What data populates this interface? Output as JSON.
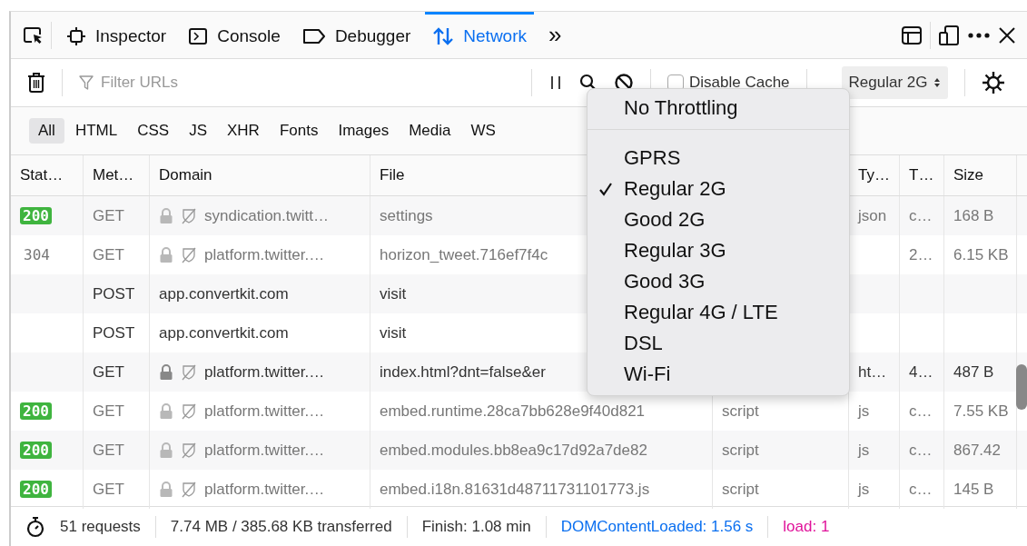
{
  "toolbar": {
    "tabs": [
      {
        "label": "Inspector",
        "selected": false
      },
      {
        "label": "Console",
        "selected": false
      },
      {
        "label": "Debugger",
        "selected": false
      },
      {
        "label": "Network",
        "selected": true
      }
    ],
    "overflow": "»"
  },
  "filter_bar": {
    "placeholder": "Filter URLs",
    "disable_cache": {
      "label": "Disable Cache",
      "checked": false
    },
    "throttle": "Regular 2G"
  },
  "type_filters": [
    {
      "label": "All",
      "selected": true
    },
    {
      "label": "HTML",
      "selected": false
    },
    {
      "label": "CSS",
      "selected": false
    },
    {
      "label": "JS",
      "selected": false
    },
    {
      "label": "XHR",
      "selected": false
    },
    {
      "label": "Fonts",
      "selected": false
    },
    {
      "label": "Images",
      "selected": false
    },
    {
      "label": "Media",
      "selected": false
    },
    {
      "label": "WS",
      "selected": false
    }
  ],
  "table": {
    "columns": [
      "Stat…",
      "Met…",
      "Domain",
      "File",
      "",
      "Ty…",
      "T…",
      "Size"
    ],
    "rows": [
      {
        "status": "200",
        "status_badge": true,
        "method": "GET",
        "secure": true,
        "faded": true,
        "domain": "syndication.twitt…",
        "file": "settings",
        "cause": "",
        "type": "json",
        "transferred": "c…",
        "size": "168 B"
      },
      {
        "status": "304",
        "status_badge": false,
        "method": "GET",
        "secure": true,
        "faded": true,
        "domain": "platform.twitter.…",
        "file": "horizon_tweet.716ef7f4c",
        "cause": "",
        "type": "",
        "transferred": "2…",
        "size": "6.15 KB"
      },
      {
        "status": "",
        "method": "POST",
        "secure": false,
        "faded": false,
        "domain": "app.convertkit.com",
        "file": "visit",
        "cause": "",
        "type": "",
        "transferred": "",
        "size": ""
      },
      {
        "status": "",
        "method": "POST",
        "secure": false,
        "faded": false,
        "domain": "app.convertkit.com",
        "file": "visit",
        "cause": "",
        "type": "",
        "transferred": "",
        "size": ""
      },
      {
        "status": "",
        "method": "GET",
        "secure": true,
        "faded": false,
        "domain": "platform.twitter.…",
        "file": "index.html?dnt=false&er",
        "cause": "",
        "type": "ht…",
        "transferred": "4…",
        "size": "487 B"
      },
      {
        "status": "200",
        "status_badge": true,
        "method": "GET",
        "secure": true,
        "faded": true,
        "domain": "platform.twitter.…",
        "file": "embed.runtime.28ca7bb628e9f40d821",
        "cause": "script",
        "type": "js",
        "transferred": "c…",
        "size": "7.55 KB"
      },
      {
        "status": "200",
        "status_badge": true,
        "method": "GET",
        "secure": true,
        "faded": true,
        "domain": "platform.twitter.…",
        "file": "embed.modules.bb8ea9c17d92a7de82",
        "cause": "script",
        "type": "js",
        "transferred": "c…",
        "size": "867.42"
      },
      {
        "status": "200",
        "status_badge": true,
        "method": "GET",
        "secure": true,
        "faded": true,
        "domain": "platform.twitter.…",
        "file": "embed.i18n.81631d48711731101773.js",
        "cause": "script",
        "type": "js",
        "transferred": "c…",
        "size": "145 B"
      }
    ]
  },
  "throttle_menu": [
    {
      "kind": "option",
      "label": "No Throttling",
      "selected": false
    },
    {
      "kind": "separator"
    },
    {
      "kind": "option",
      "label": "GPRS",
      "selected": false
    },
    {
      "kind": "option",
      "label": "Regular 2G",
      "selected": true
    },
    {
      "kind": "option",
      "label": "Good 2G",
      "selected": false
    },
    {
      "kind": "option",
      "label": "Regular 3G",
      "selected": false
    },
    {
      "kind": "option",
      "label": "Good 3G",
      "selected": false
    },
    {
      "kind": "option",
      "label": "Regular 4G / LTE",
      "selected": false
    },
    {
      "kind": "option",
      "label": "DSL",
      "selected": false
    },
    {
      "kind": "option",
      "label": "Wi-Fi",
      "selected": false
    }
  ],
  "status_bar": [
    {
      "kind": "plain",
      "text": "51 requests"
    },
    {
      "kind": "plain",
      "text": "7.74 MB / 385.68 KB transferred"
    },
    {
      "kind": "plain",
      "text": "Finish: 1.08 min"
    },
    {
      "kind": "dom",
      "text": "DOMContentLoaded: 1.56 s"
    },
    {
      "kind": "load",
      "text": "load: 1"
    }
  ]
}
